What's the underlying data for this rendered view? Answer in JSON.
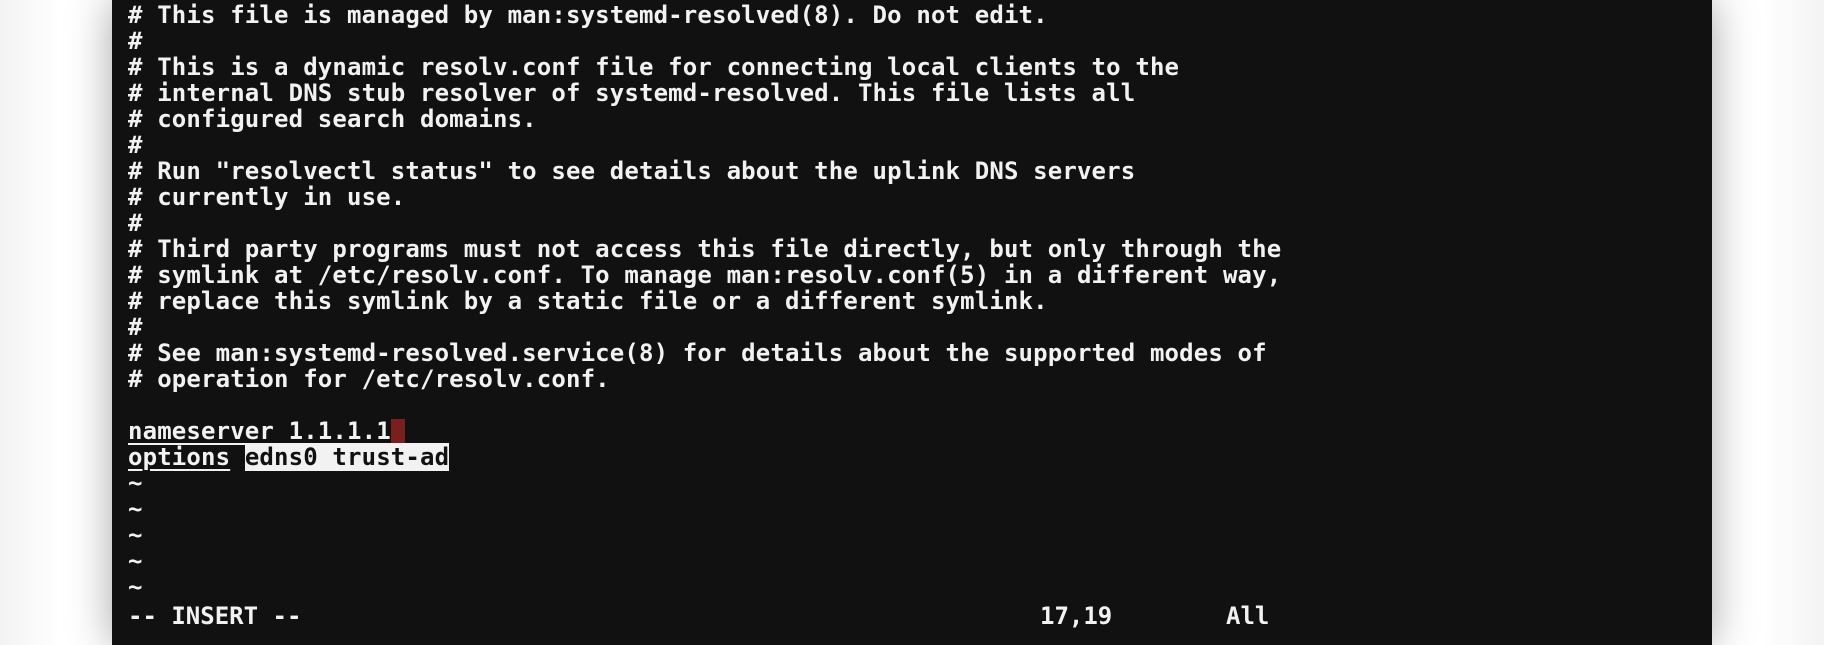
{
  "window": {
    "app": "terminal-vim"
  },
  "buffer": {
    "comments": [
      "# This file is managed by man:systemd-resolved(8). Do not edit.",
      "#",
      "# This is a dynamic resolv.conf file for connecting local clients to the",
      "# internal DNS stub resolver of systemd-resolved. This file lists all",
      "# configured search domains.",
      "#",
      "# Run \"resolvectl status\" to see details about the uplink DNS servers",
      "# currently in use.",
      "#",
      "# Third party programs must not access this file directly, but only through the",
      "# symlink at /etc/resolv.conf. To manage man:resolv.conf(5) in a different way,",
      "# replace this symlink by a static file or a different symlink.",
      "#",
      "# See man:systemd-resolved.service(8) for details about the supported modes of",
      "# operation for /etc/resolv.conf."
    ],
    "blank": "",
    "nameserver": {
      "keyword": "nameserver",
      "value": "1.1.1.1"
    },
    "options": {
      "keyword": "options",
      "value": "edns0 trust-ad"
    },
    "tildes": [
      "~",
      "~",
      "~",
      "~",
      "~"
    ]
  },
  "statusline": {
    "mode": "-- INSERT --",
    "position": "17,19",
    "scroll": "All"
  },
  "colors": {
    "background": "#111111",
    "foreground": "#f2f2f2",
    "cursor": "#7a1f1f"
  }
}
